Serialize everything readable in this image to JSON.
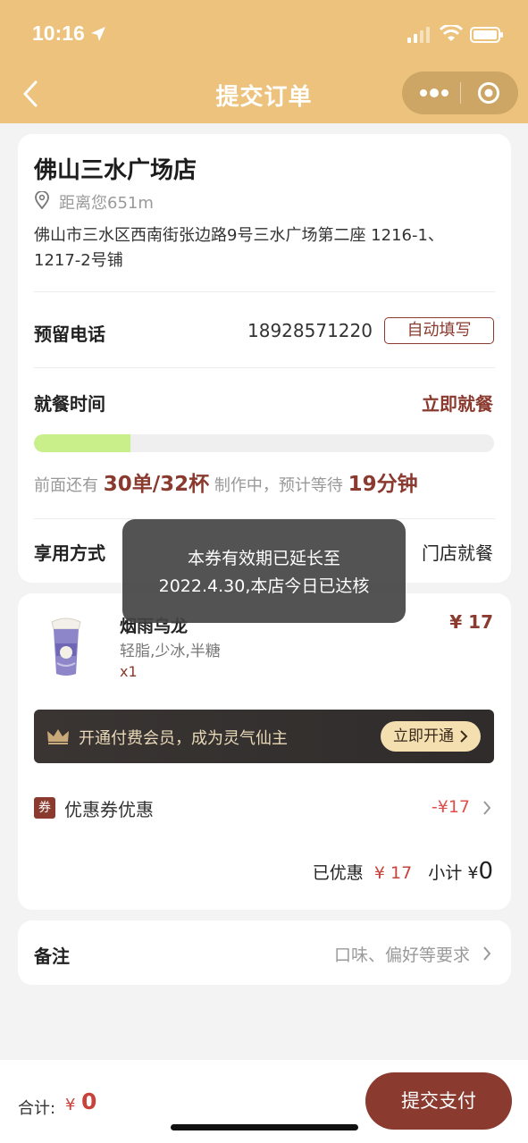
{
  "status_bar": {
    "time": "10:16"
  },
  "header": {
    "title": "提交订单"
  },
  "store": {
    "name": "佛山三水广场店",
    "distance": "距离您651m",
    "address": "佛山市三水区西南街张边路9号三水广场第二座 1216-1、1217-2号铺"
  },
  "phone_row": {
    "label": "预留电话",
    "value": "18928571220",
    "autofill": "自动填写"
  },
  "time_row": {
    "label": "就餐时间",
    "value": "立即就餐"
  },
  "queue": {
    "progress": 0.21,
    "prefix": "前面还有",
    "orders": "30单/32杯",
    "middle": "制作中，预计等待",
    "wait": "19分钟"
  },
  "enjoy_row": {
    "label": "享用方式",
    "value": "门店就餐"
  },
  "product": {
    "name": "烟雨乌龙",
    "spec": "轻脂,少冰,半糖",
    "qty": "x1",
    "price": "¥ 17"
  },
  "vip": {
    "text": "开通付费会员，成为灵气仙主",
    "button": "立即开通"
  },
  "coupon": {
    "tag": "券",
    "label": "优惠券优惠",
    "amount": "-¥17"
  },
  "summary": {
    "discount_label": "已优惠",
    "discount": "¥ 17",
    "subtotal_label": "小计",
    "yen": "¥",
    "subtotal": "0"
  },
  "remark": {
    "label": "备注",
    "placeholder": "口味、偏好等要求"
  },
  "toast": {
    "line1": "本券有效期已延长至",
    "line2": "2022.4.30,本店今日已达核"
  },
  "footer": {
    "total_label": "合计:",
    "yen": "¥",
    "total": "0",
    "pay": "提交支付"
  },
  "colors": {
    "header": "#ecc27c",
    "accent": "#8a3a2e",
    "progress": "#c9ef8a",
    "price_red": "#c8423a"
  }
}
